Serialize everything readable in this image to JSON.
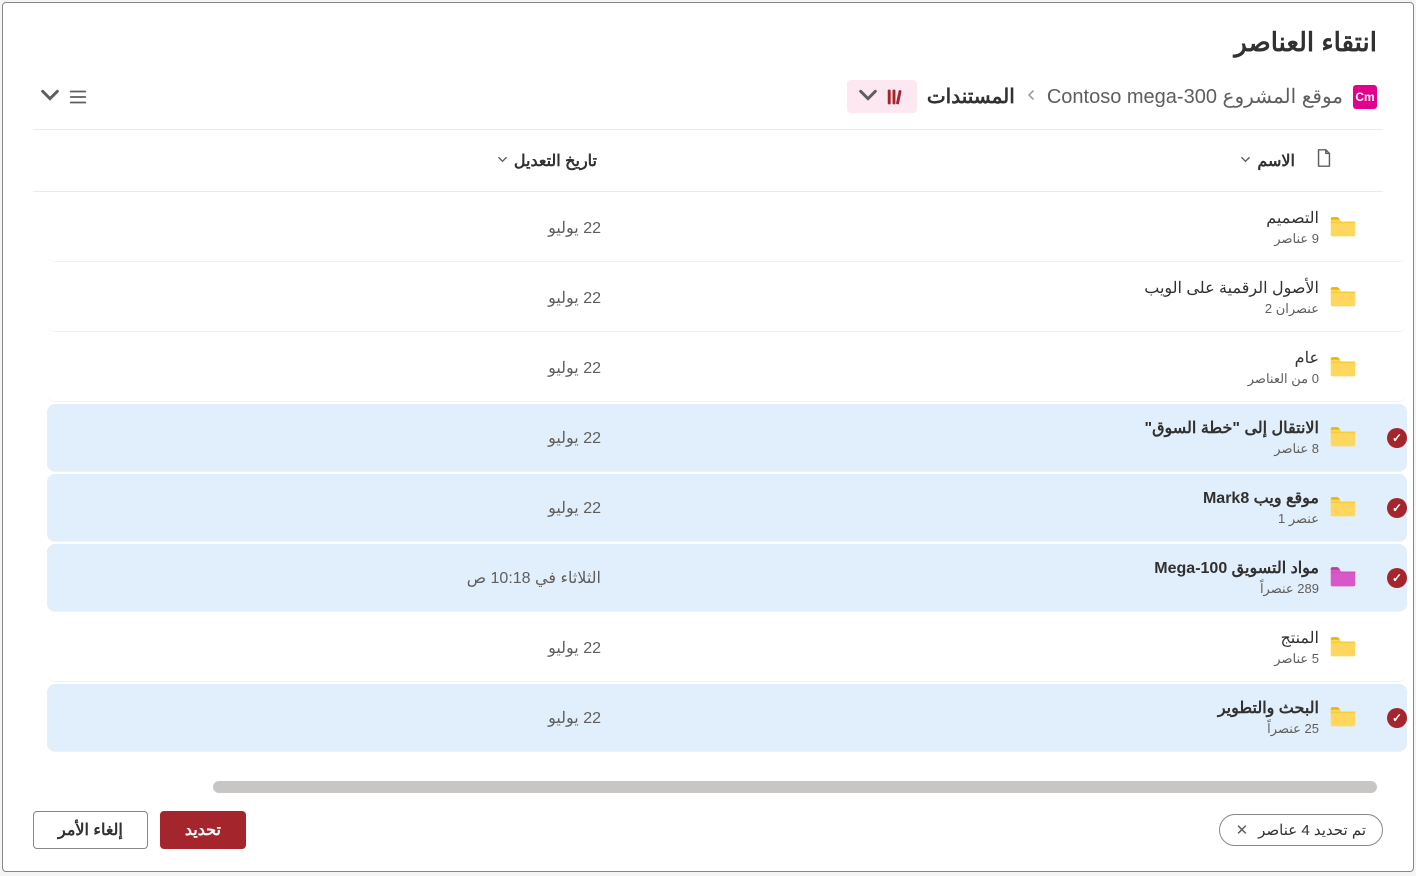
{
  "dialog_title": "انتقاء العناصر",
  "site_badge": "Cm",
  "breadcrumb": {
    "site_label": "موقع المشروع Contoso mega-300",
    "current": "المستندات"
  },
  "columns": {
    "name": "الاسم",
    "modified": "تاريخ التعديل"
  },
  "items": [
    {
      "name": "التصميم",
      "meta": "9 عناصر",
      "date": "22 يوليو",
      "selected": false,
      "color": "yellow"
    },
    {
      "name": "الأصول الرقمية على الويب",
      "meta": "عنصران 2",
      "date": "22 يوليو",
      "selected": false,
      "color": "yellow"
    },
    {
      "name": "عام",
      "meta": "0 من العناصر",
      "date": "22 يوليو",
      "selected": false,
      "color": "yellow"
    },
    {
      "name": "الانتقال إلى \"خطة السوق\"",
      "meta": "8 عناصر",
      "date": "22 يوليو",
      "selected": true,
      "color": "yellow"
    },
    {
      "name": "موقع ويب Mark8",
      "meta": "عنصر 1",
      "date": "22 يوليو",
      "selected": true,
      "color": "yellow"
    },
    {
      "name": "مواد التسويق Mega-100",
      "meta": "289 عنصراً",
      "date": "الثلاثاء في 10:18 ص",
      "selected": true,
      "color": "magenta"
    },
    {
      "name": "المنتج",
      "meta": "5 عناصر",
      "date": "22 يوليو",
      "selected": false,
      "color": "yellow"
    },
    {
      "name": "البحث والتطوير",
      "meta": "25 عنصراً",
      "date": "22 يوليو",
      "selected": true,
      "color": "yellow"
    }
  ],
  "selection_text": "تم تحديد 4 عناصر",
  "buttons": {
    "select": "تحديد",
    "cancel": "إلغاء الأمر"
  },
  "folder_colors": {
    "yellow": {
      "body": "#ffd75e",
      "tab": "#e6b800",
      "shade": "#f0c419"
    },
    "magenta": {
      "body": "#d957c9",
      "tab": "#b83aa6",
      "shade": "#c94db8"
    }
  }
}
